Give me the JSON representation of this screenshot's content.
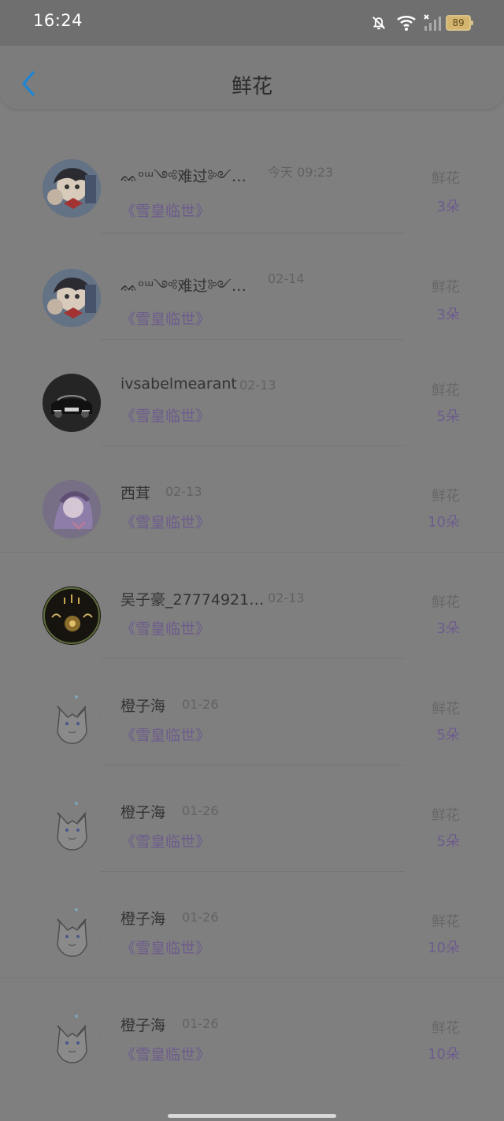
{
  "status": {
    "time": "16:24",
    "battery": "89"
  },
  "header": {
    "title": "鲜花"
  },
  "colors": {
    "accent_back": "#1b86d8",
    "book_purple": "#6d5b8d",
    "name_text": "#333333"
  },
  "items": [
    {
      "name": "ᨐᵒᵚ༺难过༻…",
      "time": "今天 09:23",
      "book": "《雪皇临世》",
      "gift": "鲜花",
      "count": "3朵",
      "avatar_icon": "anime-kid-avatar"
    },
    {
      "name": "ᨐᵒᵚ༺难过༻…",
      "time": "02-14",
      "book": "《雪皇临世》",
      "gift": "鲜花",
      "count": "3朵",
      "avatar_icon": "anime-kid-avatar"
    },
    {
      "name": "ivsabelmearant",
      "time": "02-13",
      "book": "《雪皇临世》",
      "gift": "鲜花",
      "count": "5朵",
      "avatar_icon": "car-avatar"
    },
    {
      "name": "西茸",
      "time": "02-13",
      "book": "《雪皇临世》",
      "gift": "鲜花",
      "count": "10朵",
      "avatar_icon": "purple-anime-avatar"
    },
    {
      "name": "吴子豪_27774921…",
      "time": "02-13",
      "book": "《雪皇临世》",
      "gift": "鲜花",
      "count": "3朵",
      "avatar_icon": "gold-festival-avatar"
    },
    {
      "name": "橙子海",
      "time": "01-26",
      "book": "《雪皇临世》",
      "gift": "鲜花",
      "count": "5朵",
      "avatar_icon": "catgirl-avatar"
    },
    {
      "name": "橙子海",
      "time": "01-26",
      "book": "《雪皇临世》",
      "gift": "鲜花",
      "count": "5朵",
      "avatar_icon": "catgirl-avatar"
    },
    {
      "name": "橙子海",
      "time": "01-26",
      "book": "《雪皇临世》",
      "gift": "鲜花",
      "count": "10朵",
      "avatar_icon": "catgirl-avatar"
    },
    {
      "name": "橙子海",
      "time": "01-26",
      "book": "《雪皇临世》",
      "gift": "鲜花",
      "count": "10朵",
      "avatar_icon": "catgirl-avatar"
    }
  ]
}
